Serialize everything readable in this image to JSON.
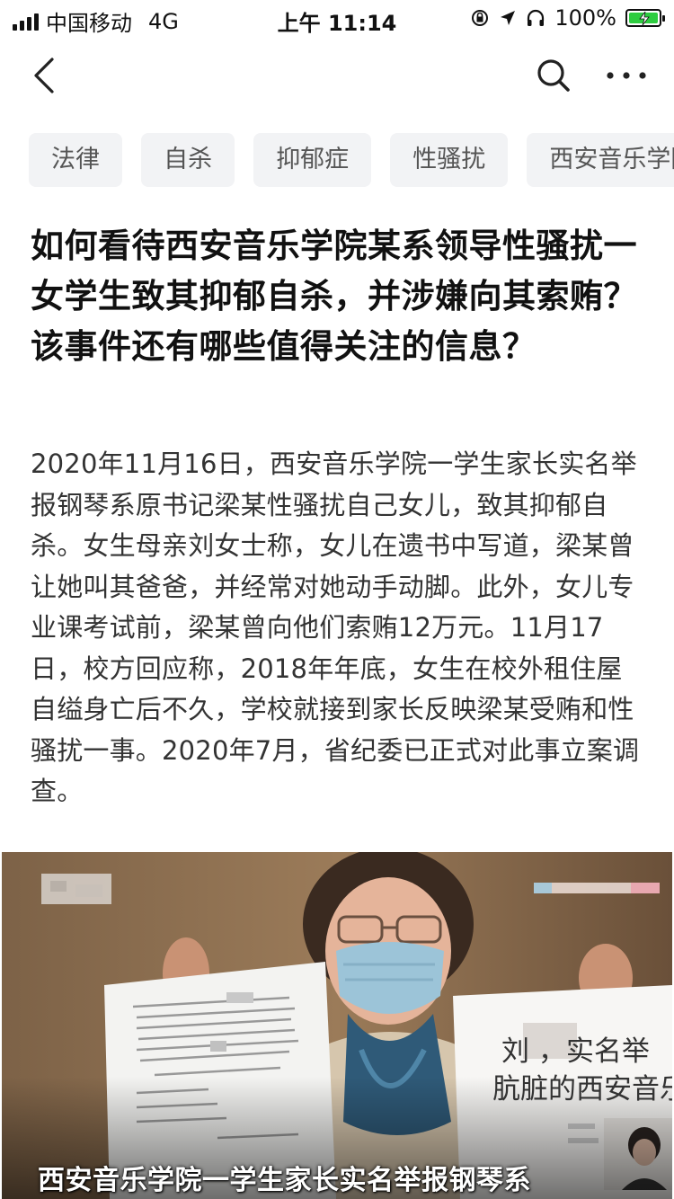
{
  "status_bar": {
    "carrier": "中国移动",
    "network": "4G",
    "time": "上午 11:14",
    "battery_pct": "100%"
  },
  "nav": {
    "back_icon": "chevron-left-icon",
    "search_icon": "search-icon",
    "more_icon": "more-horizontal-icon"
  },
  "tags": [
    "法律",
    "自杀",
    "抑郁症",
    "性骚扰",
    "西安音乐学院"
  ],
  "question": {
    "title": "如何看待西安音乐学院某系领导性骚扰一女学生致其抑郁自杀，并涉嫌向其索贿？该事件还有哪些值得关注的信息？",
    "body": "2020年11月16日，西安音乐学院一学生家长实名举报钢琴系原书记梁某性骚扰自己女儿，致其抑郁自杀。女生母亲刘女士称，女儿在遗书中写道，梁某曾让她叫其爸爸，并经常对她动手动脚。此外，女儿专业课考试前，梁某曾向他们索贿12万元。11月17日，校方回应称，2018年年底，女生在校外租住屋自缢身亡后不久，学校就接到家长反映梁某受贿和性骚扰一事。2020年7月，省纪委已正式对此事立案调查。"
  },
  "image": {
    "caption": "西安音乐学院一学生家长实名举报钢琴系",
    "sign_line1": "刘    ，实名举",
    "sign_line2": "肮脏的西安音乐"
  },
  "colors": {
    "tag_bg": "#f2f3f5",
    "battery_green": "#2ecc40"
  }
}
